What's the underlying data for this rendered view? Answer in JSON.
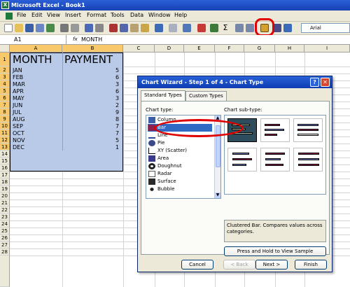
{
  "window": {
    "title": "Microsoft Excel - Book1",
    "app_icon": "X"
  },
  "menu": [
    "File",
    "Edit",
    "View",
    "Insert",
    "Format",
    "Tools",
    "Data",
    "Window",
    "Help"
  ],
  "toolbar": {
    "font_name": "Arial",
    "autosum": "Σ"
  },
  "formula_bar": {
    "name_box": "A1",
    "fx": "fx",
    "value": "MONTH"
  },
  "sheet": {
    "columns": [
      "A",
      "B",
      "C",
      "D",
      "E",
      "F",
      "G",
      "H",
      "I"
    ],
    "rows": [
      "1",
      "2",
      "3",
      "4",
      "5",
      "6",
      "7",
      "8",
      "9",
      "10",
      "11",
      "12",
      "13",
      "14",
      "15",
      "16",
      "17",
      "18",
      "19",
      "20",
      "21",
      "22",
      "23",
      "24",
      "25",
      "26",
      "27",
      "28"
    ],
    "header": {
      "a": "MONTH",
      "b": "PAYMENT"
    },
    "data": [
      {
        "month": "JAN",
        "payment": "5"
      },
      {
        "month": "FEB",
        "payment": "6"
      },
      {
        "month": "MAR",
        "payment": "3"
      },
      {
        "month": "APR",
        "payment": "6"
      },
      {
        "month": "MAY",
        "payment": "3"
      },
      {
        "month": "JUN",
        "payment": "2"
      },
      {
        "month": "JUL",
        "payment": "9"
      },
      {
        "month": "AUG",
        "payment": "8"
      },
      {
        "month": "SEP",
        "payment": "7"
      },
      {
        "month": "OCT",
        "payment": "7"
      },
      {
        "month": "NOV",
        "payment": "5"
      },
      {
        "month": "DEC",
        "payment": "1"
      }
    ]
  },
  "dialog": {
    "title": "Chart Wizard - Step 1 of 4 - Chart Type",
    "help": "?",
    "close": "✕",
    "tabs": [
      "Standard Types",
      "Custom Types"
    ],
    "chart_type_label": "Chart type:",
    "chart_types": [
      "Column",
      "Bar",
      "Line",
      "Pie",
      "XY (Scatter)",
      "Area",
      "Doughnut",
      "Radar",
      "Surface",
      "Bubble"
    ],
    "selected_type": "Bar",
    "subtype_label": "Chart sub-type:",
    "description": "Clustered Bar. Compares values across categories.",
    "sample_button": "Press and Hold to View Sample",
    "buttons": {
      "cancel": "Cancel",
      "back": "< Back",
      "next": "Next >",
      "finish": "Finish"
    },
    "accent": "#316ac5"
  }
}
